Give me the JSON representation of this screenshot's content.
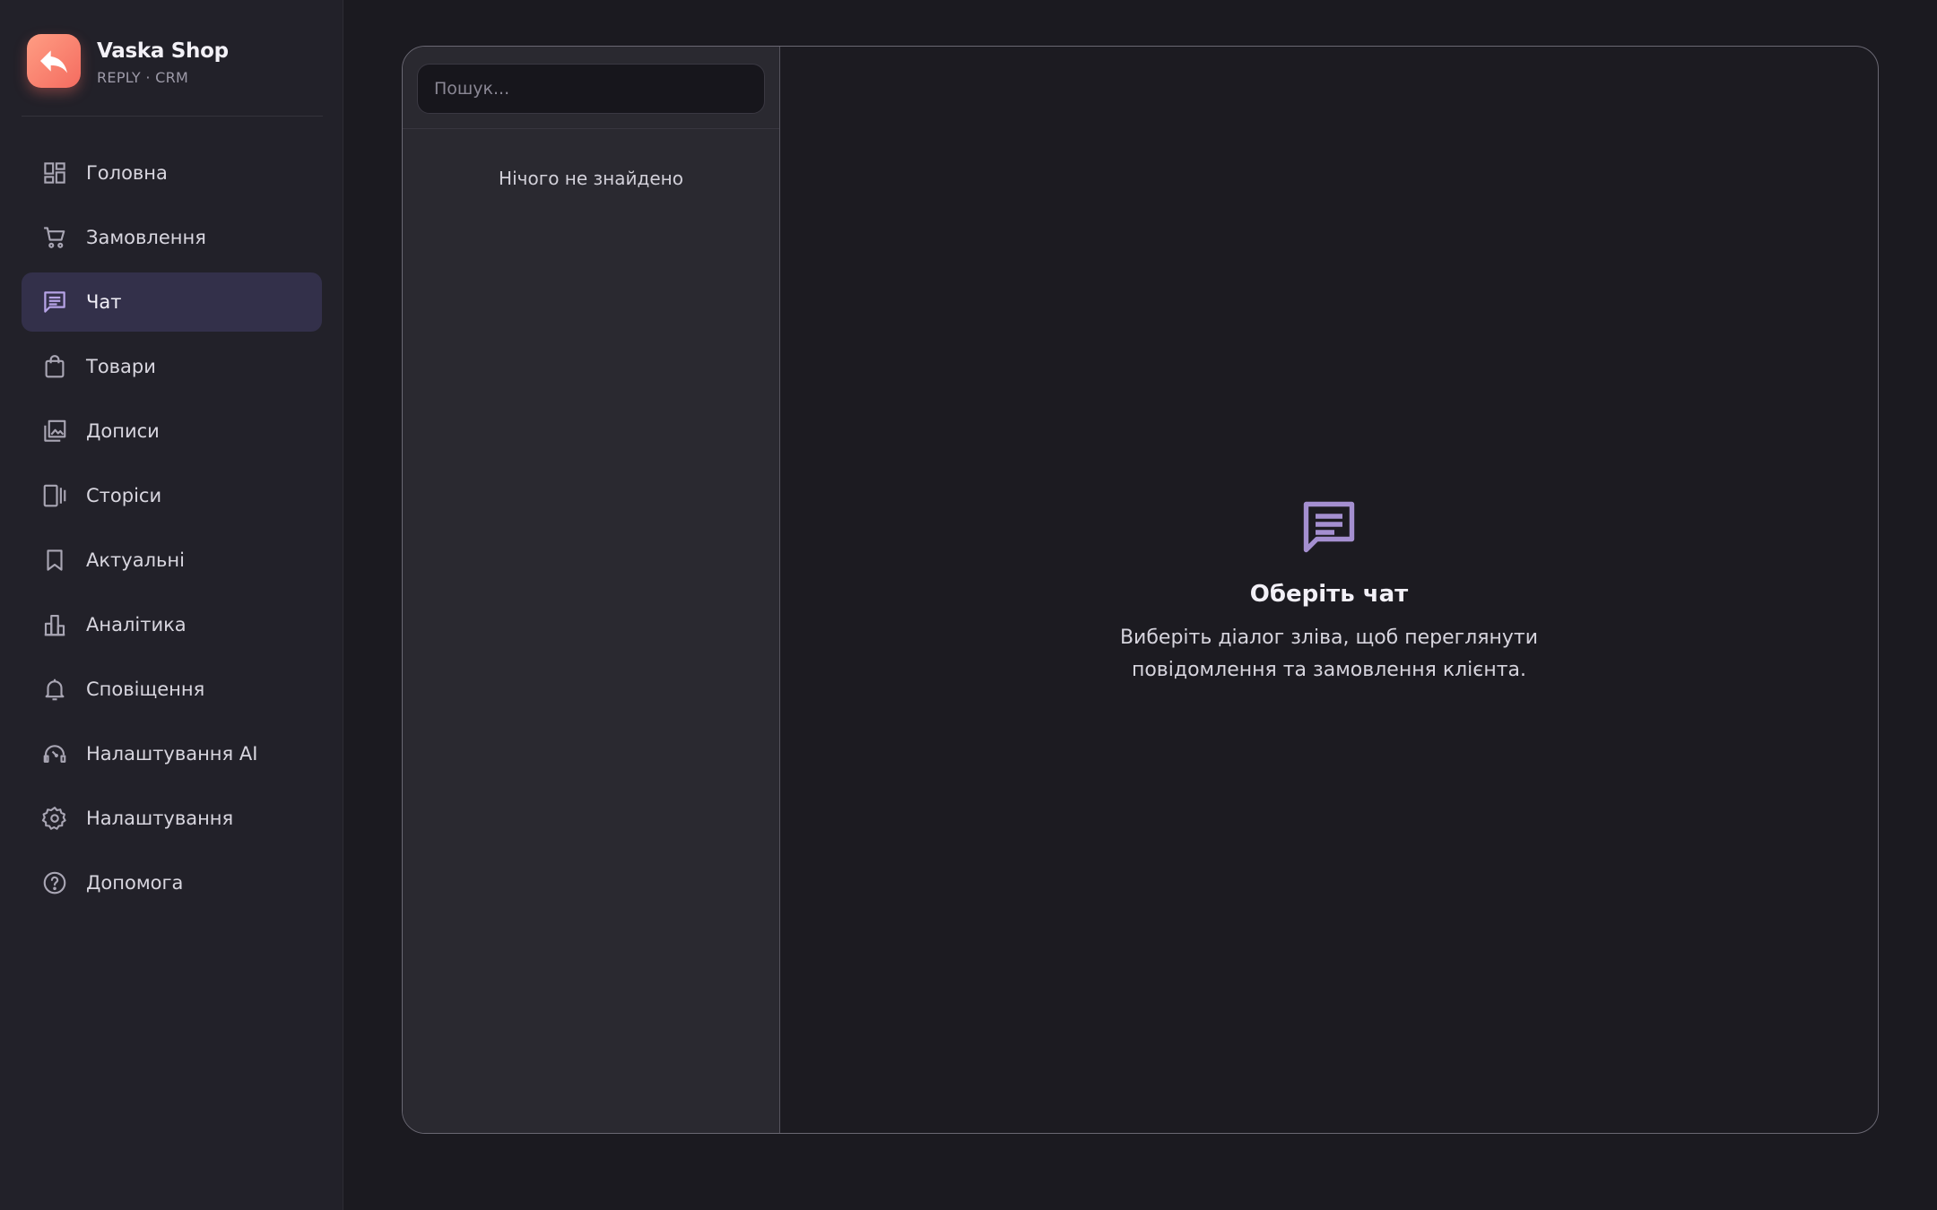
{
  "brand": {
    "name": "Vaska Shop",
    "subtitle": "REPLY · CRM",
    "logo_icon": "reply-arrow-icon",
    "logo_gradient": [
      "#ff9d83",
      "#f46c60"
    ]
  },
  "sidebar": {
    "items": [
      {
        "label": "Головна",
        "icon": "dashboard-icon",
        "active": false
      },
      {
        "label": "Замовлення",
        "icon": "cart-icon",
        "active": false
      },
      {
        "label": "Чат",
        "icon": "chat-icon",
        "active": true
      },
      {
        "label": "Товари",
        "icon": "shopping-bag-icon",
        "active": false
      },
      {
        "label": "Дописи",
        "icon": "gallery-icon",
        "active": false
      },
      {
        "label": "Сторіси",
        "icon": "stories-icon",
        "active": false
      },
      {
        "label": "Актуальні",
        "icon": "bookmark-icon",
        "active": false
      },
      {
        "label": "Аналітика",
        "icon": "bar-chart-icon",
        "active": false
      },
      {
        "label": "Сповіщення",
        "icon": "bell-icon",
        "active": false
      },
      {
        "label": "Налаштування AI",
        "icon": "ai-head-icon",
        "active": false
      },
      {
        "label": "Налаштування",
        "icon": "gear-icon",
        "active": false
      },
      {
        "label": "Допомога",
        "icon": "help-icon",
        "active": false
      }
    ]
  },
  "chat_list": {
    "search_placeholder": "Пошук...",
    "search_value": "",
    "empty_text": "Нічого не знайдено"
  },
  "chat_view": {
    "empty_icon": "chat-icon",
    "empty_title": "Оберіть чат",
    "empty_text": "Виберіть діалог зліва, щоб переглянути повідомлення та замовлення клієнта."
  },
  "colors": {
    "accent": "#a48fd0",
    "active_item_bg": "#33304a",
    "background": "#1b1a20",
    "sidebar_bg": "#222129"
  }
}
